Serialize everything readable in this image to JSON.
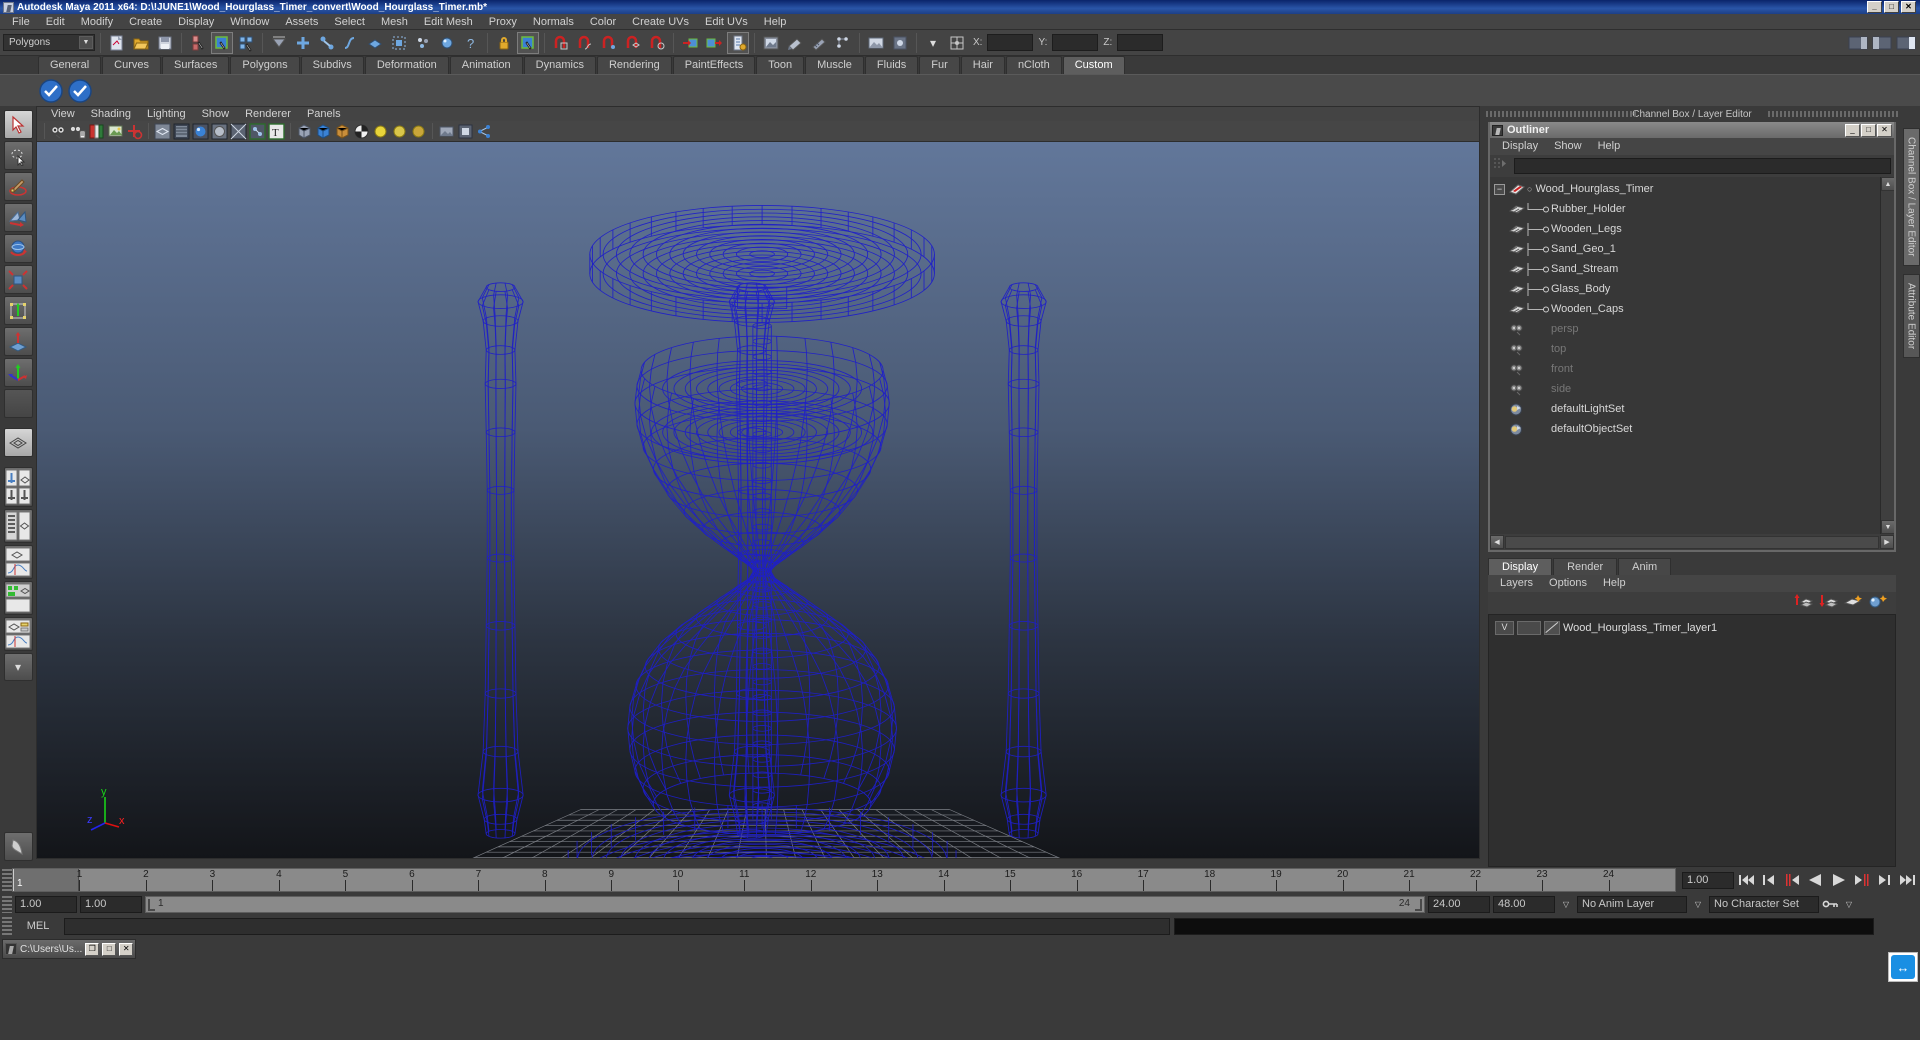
{
  "window": {
    "title": "Autodesk Maya 2011 x64: D:\\!JUNE1\\Wood_Hourglass_Timer_convert\\Wood_Hourglass_Timer.mb*",
    "minimize": "_",
    "maximize": "□",
    "close": "✕",
    "app_icon": "maya-icon"
  },
  "menubar": {
    "items": [
      "File",
      "Edit",
      "Modify",
      "Create",
      "Display",
      "Window",
      "Assets",
      "Select",
      "Mesh",
      "Edit Mesh",
      "Proxy",
      "Normals",
      "Color",
      "Create UVs",
      "Edit UVs",
      "Help"
    ]
  },
  "statusline": {
    "mode_select": "Polygons",
    "axis_labels": [
      "X:",
      "Y:",
      "Z:"
    ],
    "x_value": "",
    "y_value": "",
    "z_value": ""
  },
  "shelf": {
    "tabs": [
      "General",
      "Curves",
      "Surfaces",
      "Polygons",
      "Subdivs",
      "Deformation",
      "Animation",
      "Dynamics",
      "Rendering",
      "PaintEffects",
      "Toon",
      "Muscle",
      "Fluids",
      "Fur",
      "Hair",
      "nCloth",
      "Custom"
    ],
    "selected_tab": "Custom",
    "buttons": [
      "custom-shelf-icon-1",
      "custom-shelf-icon-2"
    ]
  },
  "toolbox": {
    "items": [
      {
        "name": "select-tool",
        "selected": true
      },
      {
        "name": "lasso-select-tool",
        "selected": false
      },
      {
        "name": "paint-select-tool",
        "selected": false
      },
      {
        "name": "move-tool",
        "selected": false
      },
      {
        "name": "rotate-tool",
        "selected": false
      },
      {
        "name": "scale-tool",
        "selected": false
      },
      {
        "name": "universal-manipulator-tool",
        "selected": false
      },
      {
        "name": "soft-modification-tool",
        "selected": false
      },
      {
        "name": "last-tool-used",
        "selected": false
      },
      {
        "name": "blank-slot",
        "selected": false
      }
    ],
    "layout_items": [
      {
        "name": "single-perspective-view-layout",
        "selected": true
      },
      {
        "name": "four-view-layout",
        "selected": false
      },
      {
        "name": "two-pane-side-layout",
        "selected": false
      },
      {
        "name": "outliner-persp-layout",
        "selected": false
      },
      {
        "name": "persp-graph-editor-layout",
        "selected": false
      },
      {
        "name": "hypershade-persp-layout",
        "selected": false
      },
      {
        "name": "persp-hypergraph-layout",
        "selected": false
      },
      {
        "name": "more-layouts-dropdown",
        "selected": false
      }
    ]
  },
  "viewport": {
    "menu": [
      "View",
      "Shading",
      "Lighting",
      "Show",
      "Renderer",
      "Panels"
    ],
    "toolbar_icons": [
      "select-camera-icon",
      "camera-attributes-icon",
      "bookmarks-icon",
      "image-plane-icon",
      "2d-pan-zoom-icon",
      "wireframe-icon",
      "smooth-shade-icon",
      "hardware-texturing-icon",
      "lighting-icon",
      "xray-icon",
      "xray-joints-icon",
      "show-manipulator-icon",
      "display-resolution-gate-icon",
      "shadows-icon",
      "occlusion-icon",
      "motion-blur-icon",
      "light-1-icon",
      "light-2-icon",
      "light-3-icon",
      "exposure-icon",
      "grid-icon",
      "isolate-select-icon",
      "panel-share-icon"
    ],
    "axis_gizmo": {
      "y": "y",
      "z": "z",
      "x": "x"
    },
    "wireframe_color": "#1a1ab4",
    "background_top": "#5a6e8c",
    "background_bottom": "#15171c",
    "grid_color": "#8d9098",
    "model_name": "Wood_Hourglass_Timer"
  },
  "right_panel": {
    "header_label": "Channel Box / Layer Editor",
    "vertical_tabs": [
      {
        "label": "Channel Box / Layer Editor",
        "selected": true
      },
      {
        "label": "Attribute Editor",
        "selected": false
      }
    ]
  },
  "outliner": {
    "title": "Outliner",
    "window_buttons": {
      "minimize": "_",
      "restore": "□",
      "close": "✕"
    },
    "menu": [
      "Display",
      "Show",
      "Help"
    ],
    "search_value": "",
    "rows": [
      {
        "label": "Wood_Hourglass_Timer",
        "icon": "transform-icon",
        "depth": 0,
        "expander": "−",
        "dim": false,
        "child": false
      },
      {
        "label": "Rubber_Holder",
        "icon": "mesh-icon",
        "depth": 1,
        "dim": false,
        "child": true
      },
      {
        "label": "Wooden_Legs",
        "icon": "mesh-icon",
        "depth": 1,
        "dim": false,
        "child": true
      },
      {
        "label": "Sand_Geo_1",
        "icon": "mesh-icon",
        "depth": 1,
        "dim": false,
        "child": true
      },
      {
        "label": "Sand_Stream",
        "icon": "mesh-icon",
        "depth": 1,
        "dim": false,
        "child": true
      },
      {
        "label": "Glass_Body",
        "icon": "mesh-icon",
        "depth": 1,
        "dim": false,
        "child": true
      },
      {
        "label": "Wooden_Caps",
        "icon": "mesh-icon",
        "depth": 1,
        "dim": false,
        "child": true
      },
      {
        "label": "persp",
        "icon": "camera-icon",
        "depth": 0,
        "dim": true,
        "child": false
      },
      {
        "label": "top",
        "icon": "camera-icon",
        "depth": 0,
        "dim": true,
        "child": false
      },
      {
        "label": "front",
        "icon": "camera-icon",
        "depth": 0,
        "dim": true,
        "child": false
      },
      {
        "label": "side",
        "icon": "camera-icon",
        "depth": 0,
        "dim": true,
        "child": false
      },
      {
        "label": "defaultLightSet",
        "icon": "set-icon",
        "depth": 0,
        "dim": false,
        "child": false
      },
      {
        "label": "defaultObjectSet",
        "icon": "set-icon",
        "depth": 0,
        "dim": false,
        "child": false
      }
    ]
  },
  "layer_editor": {
    "tabs": [
      "Display",
      "Render",
      "Anim"
    ],
    "selected_tab": "Display",
    "menu": [
      "Layers",
      "Options",
      "Help"
    ],
    "buttons": [
      "move-layer-up-icon",
      "move-layer-down-icon",
      "new-empty-layer-icon",
      "new-layer-from-selected-icon"
    ],
    "layers": [
      {
        "visibility": "V",
        "playback": "",
        "name": "Wood_Hourglass_Timer_layer1"
      }
    ]
  },
  "time_slider": {
    "ticks": [
      "1",
      "2",
      "3",
      "4",
      "5",
      "6",
      "7",
      "8",
      "9",
      "10",
      "11",
      "12",
      "13",
      "14",
      "15",
      "16",
      "17",
      "18",
      "19",
      "20",
      "21",
      "22",
      "23",
      "24"
    ],
    "current_frame": "1",
    "current_time_field": "1.00",
    "playback_buttons": [
      "go-to-start-icon",
      "step-back-frame-icon",
      "step-back-key-icon",
      "play-backwards-icon",
      "play-forwards-icon",
      "step-forward-key-icon",
      "step-forward-frame-icon",
      "go-to-end-icon"
    ]
  },
  "range_slider": {
    "anim_start": "1.00",
    "range_start": "1.00",
    "bar_start_label": "1",
    "bar_end_label": "24",
    "range_end": "24.00",
    "anim_end": "48.00",
    "anim_layer": "No Anim Layer",
    "character_set": "No Character Set",
    "key_icon": "key-icon"
  },
  "command_line": {
    "label": "MEL",
    "input_value": "",
    "output_value": ""
  },
  "taskbar": {
    "item_label": "C:\\Users\\Us...",
    "buttons": {
      "restore": "❐",
      "maximize": "□",
      "close": "✕"
    }
  },
  "help_widget": {
    "icon": "teamviewer-arrows-icon"
  }
}
